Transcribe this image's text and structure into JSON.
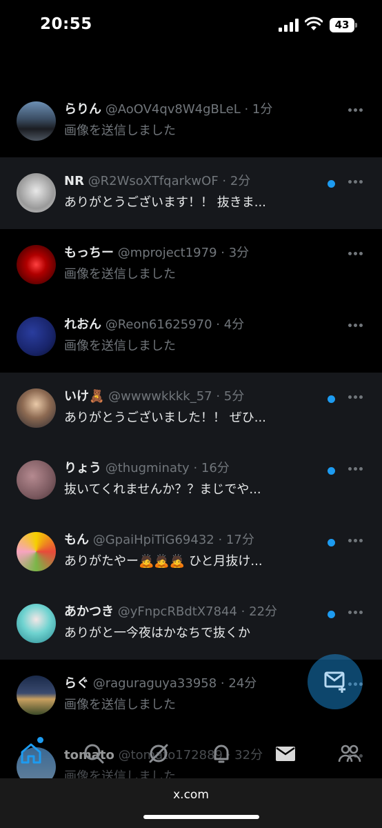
{
  "status": {
    "time": "20:55",
    "battery": "43"
  },
  "conversations": [
    {
      "name": "",
      "handle": "",
      "time": "",
      "preview": "画像を送信しました",
      "unread": false,
      "avatar": "avatar-white-figure"
    },
    {
      "name": "らりん",
      "handle": "@AoOV4qv8W4gBLeL",
      "time": "· 1分",
      "preview": "画像を送信しました",
      "unread": false,
      "avatar": "avatar-car"
    },
    {
      "name": "NR",
      "handle": "@R2WsoXTfqarkwOF",
      "time": "· 2分",
      "preview": "ありがとうございます！！ 抜きま...",
      "unread": true,
      "avatar": "avatar-sketch"
    },
    {
      "name": "もっちー",
      "handle": "@mproject1979",
      "time": "· 3分",
      "preview": "画像を送信しました",
      "unread": false,
      "avatar": "avatar-red-jumpman"
    },
    {
      "name": "れおん",
      "handle": "@Reon61625970",
      "time": "· 4分",
      "preview": "画像を送信しました",
      "unread": false,
      "avatar": "avatar-blue-night"
    },
    {
      "name": "いけ🧸",
      "handle": "@wwwwkkkk_57",
      "time": "· 5分",
      "preview": "ありがとうございました！！ ぜひ...",
      "unread": true,
      "avatar": "avatar-glasses-man"
    },
    {
      "name": "りょう",
      "handle": "@thugminaty",
      "time": "· 16分",
      "preview": "抜いてくれませんか？？まじでや...",
      "unread": true,
      "avatar": "avatar-blur-pink"
    },
    {
      "name": "もん",
      "handle": "@GpaiHpiTiG69432",
      "time": "· 17分",
      "preview": "ありがたやー🙇🙇🙇 ひと月抜け...",
      "unread": true,
      "avatar": "avatar-flowers"
    },
    {
      "name": "あかつき",
      "handle": "@yFnpcRBdtX7844",
      "time": "· 22分",
      "preview": "ありがと一今夜はかなちで抜くか",
      "unread": true,
      "avatar": "avatar-anime-teal"
    },
    {
      "name": "らぐ",
      "handle": "@raguraguya33958",
      "time": "· 24分",
      "preview": "画像を送信しました",
      "unread": false,
      "avatar": "avatar-sunset-field"
    },
    {
      "name": "tomato",
      "handle": "@tomato172889",
      "time": "· 32分",
      "preview": "画像を送信しました",
      "unread": false,
      "avatar": "avatar-sky"
    }
  ],
  "fab": {
    "icon": "new-message-icon"
  },
  "nav": [
    {
      "icon": "home-icon"
    },
    {
      "icon": "search-icon"
    },
    {
      "icon": "grok-icon"
    },
    {
      "icon": "notifications-icon"
    },
    {
      "icon": "messages-icon"
    },
    {
      "icon": "communities-icon"
    }
  ],
  "browser": {
    "url": "x.com"
  },
  "colors": {
    "accent": "#1d9bf0",
    "unread_bg": "#16181c",
    "muted": "#71767b"
  }
}
